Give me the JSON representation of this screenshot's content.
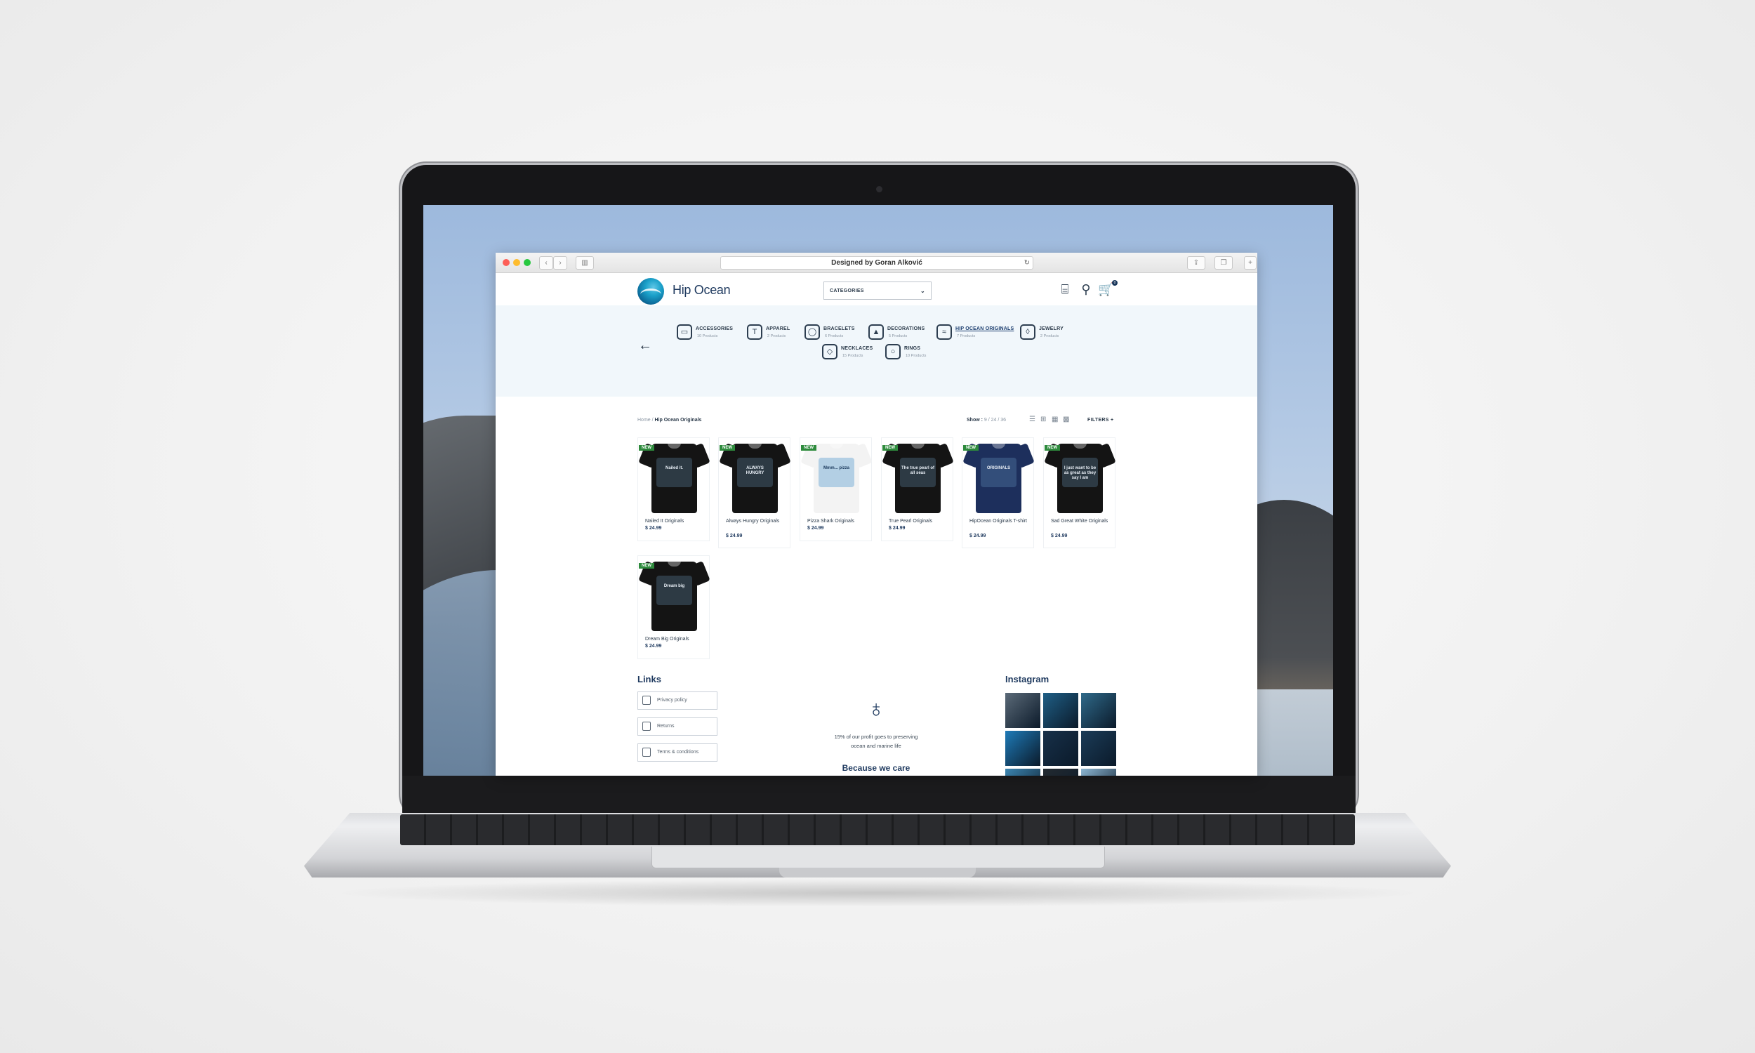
{
  "browser": {
    "url_title": "Designed by Goran Alković",
    "reload_icon": "reload-icon"
  },
  "site": {
    "brand": "Hip Ocean",
    "categories_dropdown": "CATEGORIES",
    "header_icons": [
      "bag-icon",
      "search-icon",
      "cart-icon"
    ],
    "cart_count": "0"
  },
  "categories": [
    {
      "name": "ACCESSORIES",
      "count": "10 Products",
      "icon": "backpack-icon",
      "glyph": "▭"
    },
    {
      "name": "APPAREL",
      "count": "2 Products",
      "icon": "tshirt-icon",
      "glyph": "T"
    },
    {
      "name": "BRACELETS",
      "count": "6 Products",
      "icon": "bracelet-icon",
      "glyph": "◯"
    },
    {
      "name": "DECORATIONS",
      "count": "5 Products",
      "icon": "picture-icon",
      "glyph": "▲"
    },
    {
      "name": "HIP OCEAN ORIGINALS",
      "count": "7 Products",
      "icon": "wave-icon",
      "glyph": "≈"
    },
    {
      "name": "JEWELRY",
      "count": "2 Products",
      "icon": "earrings-icon",
      "glyph": "◊"
    },
    {
      "name": "NECKLACES",
      "count": "15 Products",
      "icon": "necklace-icon",
      "glyph": "◇"
    },
    {
      "name": "RINGS",
      "count": "10 Products",
      "icon": "ring-icon",
      "glyph": "○"
    }
  ],
  "breadcrumb": {
    "home": "Home /",
    "current": "Hip Ocean Originals"
  },
  "toolbar": {
    "show_label": "Show :",
    "show_options": "9 / 24 / 36",
    "filters_label": "FILTERS +"
  },
  "products": [
    {
      "name": "Nailed It Originals",
      "price": "$ 24.99",
      "badge": "NEW",
      "shirt_color": "#141414",
      "print_text": "Nailed it."
    },
    {
      "name": "Always Hungry Originals",
      "price": "$ 24.99",
      "badge": "NEW",
      "shirt_color": "#141414",
      "print_text": "ALWAYS HUNGRY"
    },
    {
      "name": "Pizza Shark Originals",
      "price": "$ 24.99",
      "badge": "NEW",
      "shirt_color": "#f3f3f3",
      "print_text": "Mmm... pizza"
    },
    {
      "name": "True Pearl Originals",
      "price": "$ 24.99",
      "badge": "NEW",
      "shirt_color": "#141414",
      "print_text": "The true pearl of all seas"
    },
    {
      "name": "HipOcean Originals T-shirt",
      "price": "$ 24.99",
      "badge": "NEW",
      "shirt_color": "#1d2f5c",
      "print_text": "ORIGINALS"
    },
    {
      "name": "Sad Great White Originals",
      "price": "$ 24.99",
      "badge": "NEW",
      "shirt_color": "#141414",
      "print_text": "I just want to be as great as they say I am"
    },
    {
      "name": "Dream Big Originals",
      "price": "$ 24.99",
      "badge": "NEW",
      "shirt_color": "#141414",
      "print_text": "Dream big"
    }
  ],
  "footer": {
    "links_title": "Links",
    "links": [
      {
        "label": "Privacy policy",
        "icon": "shield-icon"
      },
      {
        "label": "Returns",
        "icon": "returns-icon"
      },
      {
        "label": "Terms & conditions",
        "icon": "document-icon"
      }
    ],
    "care_text": "15% of our profit goes to preserving ocean and marine life",
    "care_title": "Because we care",
    "instagram_title": "Instagram",
    "instagram_colors": [
      "#5b6a78",
      "#1f5f86",
      "#2f6a8a",
      "#1e7bb8",
      "#173049",
      "#1b3c58",
      "#3c85b0",
      "#232a30",
      "#8cb6d2"
    ]
  }
}
